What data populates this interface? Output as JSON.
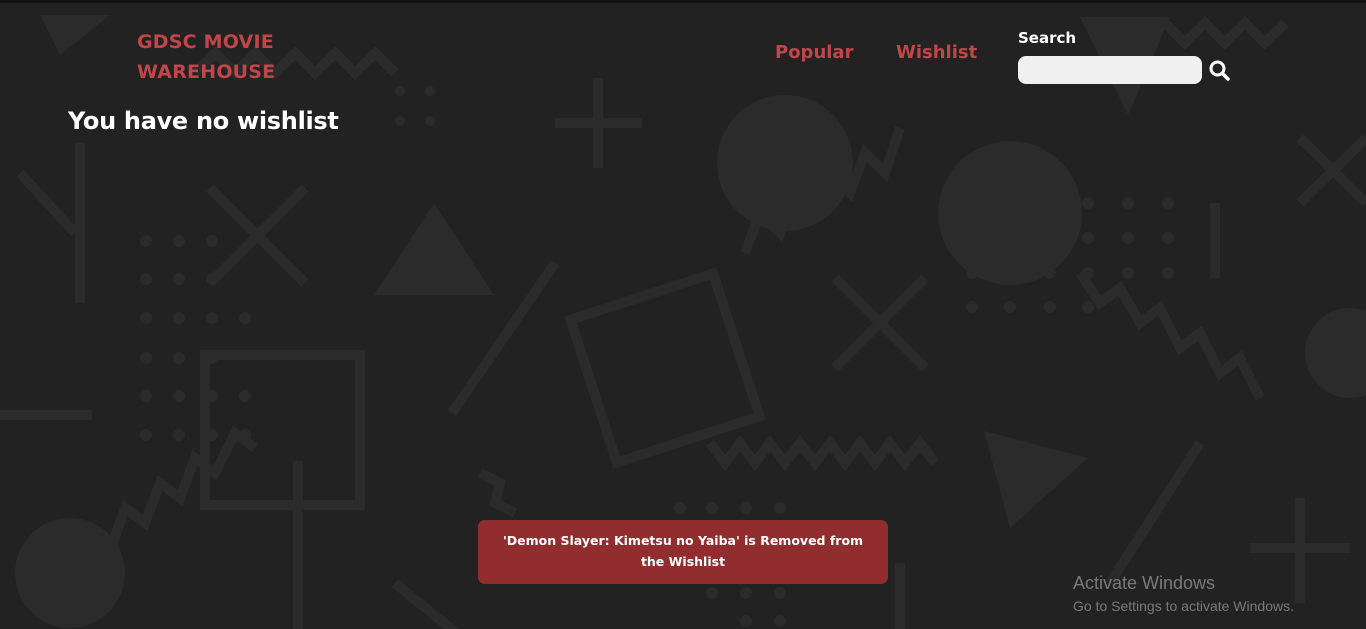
{
  "header": {
    "brand_line1": "GDSC MOVIE",
    "brand_line2": "WAREHOUSE",
    "nav": {
      "popular": "Popular",
      "wishlist": "Wishlist"
    },
    "search": {
      "label": "Search",
      "value": "",
      "placeholder": ""
    }
  },
  "main": {
    "heading": "You have no wishlist"
  },
  "toast": {
    "message": "'Demon Slayer: Kimetsu no Yaiba' is Removed from the Wishlist"
  },
  "os_overlay": {
    "title": "Activate Windows",
    "subtitle": "Go to Settings to activate Windows."
  },
  "colors": {
    "background": "#222222",
    "accent": "#c0464a",
    "toast_bg": "#912d2f",
    "text": "#ffffff"
  },
  "icons": {
    "search": "magnifier-icon"
  }
}
